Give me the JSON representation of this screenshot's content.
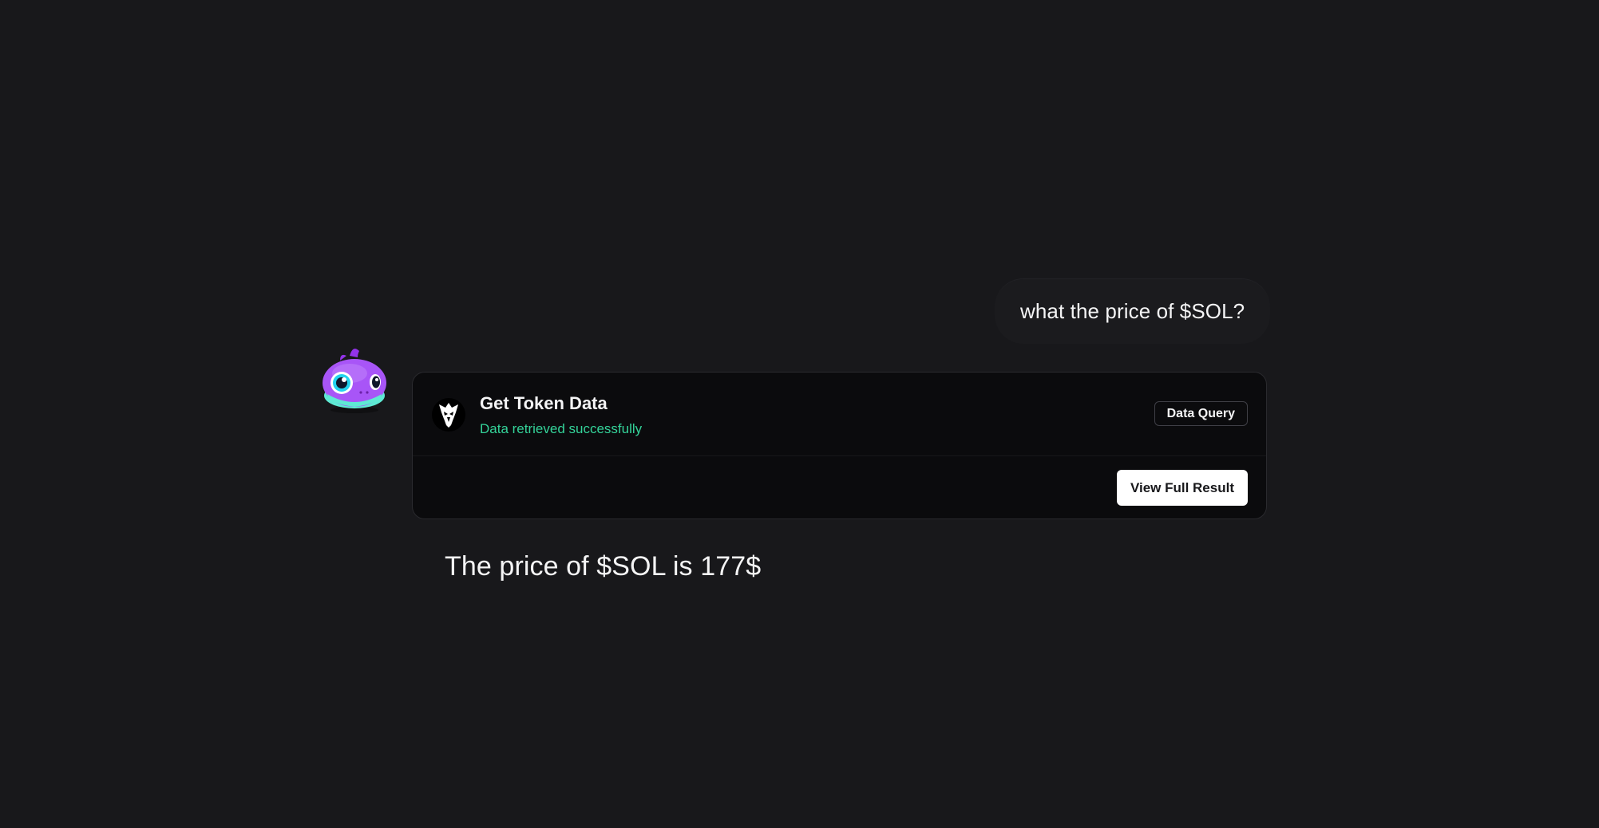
{
  "user_message": {
    "text": "what the price of $SOL?"
  },
  "assistant": {
    "avatar_icon": "purple-dino-mascot-icon",
    "tool_call": {
      "icon": "eagle-icon",
      "title": "Get Token Data",
      "status": "Data retrieved successfully",
      "badge": "Data Query",
      "button_label": "View Full Result"
    },
    "reply_text": "The price of $SOL is 177$"
  },
  "colors": {
    "background": "#18181b",
    "card_background": "#0b0b0d",
    "success_text": "#34d399",
    "mascot": "#a855f7",
    "mascot_belly": "#5eead4",
    "button_background": "#ffffff"
  }
}
